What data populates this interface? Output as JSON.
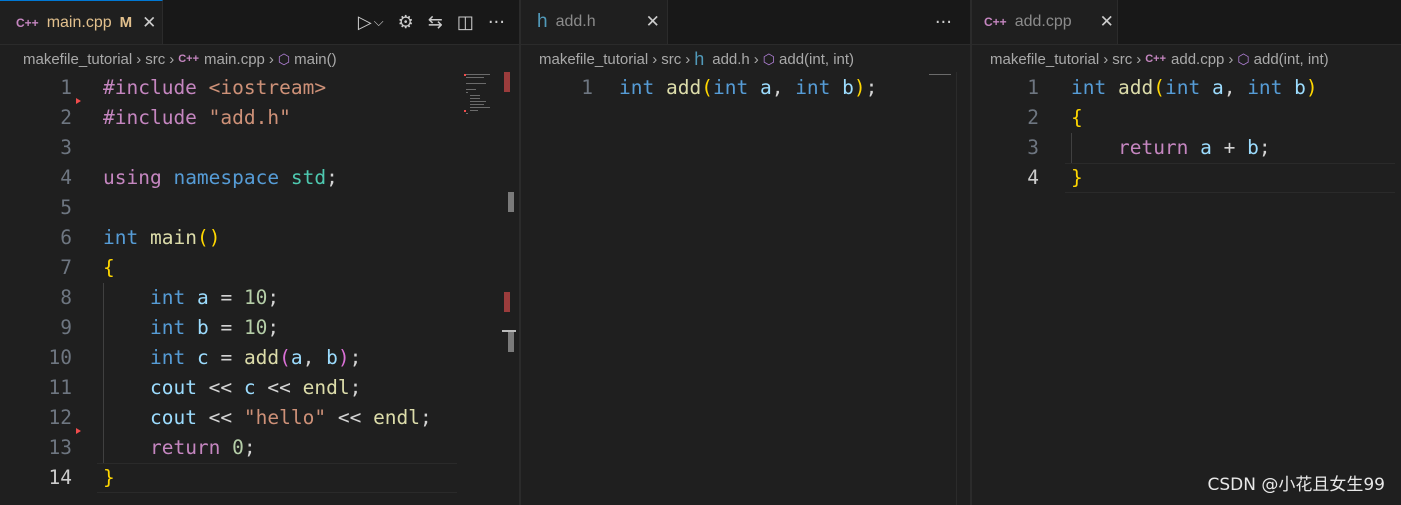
{
  "panes": {
    "main": {
      "tab": {
        "icon": "C++",
        "name": "main.cpp",
        "status": "M",
        "close": "✕"
      },
      "actions": {
        "run": "▷",
        "run_dropdown": "⌵",
        "settings": "⚙",
        "compare": "⇆",
        "split": "◫",
        "more": "···"
      },
      "breadcrumb": {
        "folder": "makefile_tutorial",
        "sub": "src",
        "file_icon": "C++",
        "file": "main.cpp",
        "symbol": "main()"
      },
      "line_numbers": [
        "1",
        "2",
        "3",
        "4",
        "5",
        "6",
        "7",
        "8",
        "9",
        "10",
        "11",
        "12",
        "13",
        "14"
      ]
    },
    "header": {
      "tab": {
        "icon": "h",
        "name": "add.h",
        "close": "✕"
      },
      "actions": {
        "more": "···"
      },
      "breadcrumb": {
        "folder": "makefile_tutorial",
        "sub": "src",
        "file_icon": "h",
        "file": "add.h",
        "symbol": "add(int, int)"
      },
      "line_numbers": [
        "1"
      ]
    },
    "impl": {
      "tab": {
        "icon": "C++",
        "name": "add.cpp",
        "close": "✕"
      },
      "breadcrumb": {
        "folder": "makefile_tutorial",
        "sub": "src",
        "file_icon": "C++",
        "file": "add.cpp",
        "symbol": "add(int, int)"
      },
      "line_numbers": [
        "1",
        "2",
        "3",
        "4"
      ]
    }
  },
  "code": {
    "main": [
      [
        [
          "#include",
          "pp"
        ],
        [
          " ",
          "p"
        ],
        [
          "<iostream>",
          "s"
        ]
      ],
      [
        [
          "#include",
          "pp"
        ],
        [
          " ",
          "p"
        ],
        [
          "\"add.h\"",
          "s"
        ]
      ],
      [],
      [
        [
          "using",
          "pp"
        ],
        [
          " ",
          "p"
        ],
        [
          "namespace",
          "k"
        ],
        [
          " ",
          "p"
        ],
        [
          "std",
          "t"
        ],
        [
          ";",
          "p"
        ]
      ],
      [],
      [
        [
          "int",
          "k"
        ],
        [
          " ",
          "p"
        ],
        [
          "main",
          "f"
        ],
        [
          "()",
          "b1"
        ]
      ],
      [
        [
          "{",
          "b1"
        ]
      ],
      [
        [
          "    ",
          "p"
        ],
        [
          "int",
          "k"
        ],
        [
          " ",
          "p"
        ],
        [
          "a",
          "v"
        ],
        [
          " = ",
          "p"
        ],
        [
          "10",
          "n"
        ],
        [
          ";",
          "p"
        ]
      ],
      [
        [
          "    ",
          "p"
        ],
        [
          "int",
          "k"
        ],
        [
          " ",
          "p"
        ],
        [
          "b",
          "v"
        ],
        [
          " = ",
          "p"
        ],
        [
          "10",
          "n"
        ],
        [
          ";",
          "p"
        ]
      ],
      [
        [
          "    ",
          "p"
        ],
        [
          "int",
          "k"
        ],
        [
          " ",
          "p"
        ],
        [
          "c",
          "v"
        ],
        [
          " = ",
          "p"
        ],
        [
          "add",
          "f"
        ],
        [
          "(",
          "b2"
        ],
        [
          "a",
          "v"
        ],
        [
          ", ",
          "p"
        ],
        [
          "b",
          "v"
        ],
        [
          ")",
          "b2"
        ],
        [
          ";",
          "p"
        ]
      ],
      [
        [
          "    ",
          "p"
        ],
        [
          "cout",
          "v"
        ],
        [
          " << ",
          "p"
        ],
        [
          "c",
          "v"
        ],
        [
          " << ",
          "p"
        ],
        [
          "endl",
          "f"
        ],
        [
          ";",
          "p"
        ]
      ],
      [
        [
          "    ",
          "p"
        ],
        [
          "cout",
          "v"
        ],
        [
          " << ",
          "p"
        ],
        [
          "\"hello\"",
          "s"
        ],
        [
          " << ",
          "p"
        ],
        [
          "endl",
          "f"
        ],
        [
          ";",
          "p"
        ]
      ],
      [
        [
          "    ",
          "p"
        ],
        [
          "return",
          "pp"
        ],
        [
          " ",
          "p"
        ],
        [
          "0",
          "n"
        ],
        [
          ";",
          "p"
        ]
      ],
      [
        [
          "}",
          "b1"
        ]
      ]
    ],
    "header": [
      [
        [
          "int",
          "k"
        ],
        [
          " ",
          "p"
        ],
        [
          "add",
          "f"
        ],
        [
          "(",
          "b1"
        ],
        [
          "int",
          "k"
        ],
        [
          " ",
          "p"
        ],
        [
          "a",
          "v"
        ],
        [
          ", ",
          "p"
        ],
        [
          "int",
          "k"
        ],
        [
          " ",
          "p"
        ],
        [
          "b",
          "v"
        ],
        [
          ")",
          "b1"
        ],
        [
          ";",
          "p"
        ]
      ]
    ],
    "impl": [
      [
        [
          "int",
          "k"
        ],
        [
          " ",
          "p"
        ],
        [
          "add",
          "f"
        ],
        [
          "(",
          "b1"
        ],
        [
          "int",
          "k"
        ],
        [
          " ",
          "p"
        ],
        [
          "a",
          "v"
        ],
        [
          ", ",
          "p"
        ],
        [
          "int",
          "k"
        ],
        [
          " ",
          "p"
        ],
        [
          "b",
          "v"
        ],
        [
          ")",
          "b1"
        ]
      ],
      [
        [
          "{",
          "b1"
        ]
      ],
      [
        [
          "    ",
          "p"
        ],
        [
          "return",
          "pp"
        ],
        [
          " ",
          "p"
        ],
        [
          "a",
          "v"
        ],
        [
          " + ",
          "p"
        ],
        [
          "b",
          "v"
        ],
        [
          ";",
          "p"
        ]
      ],
      [
        [
          "}",
          "b1"
        ]
      ]
    ]
  },
  "colors": {
    "keyword": "#569cd6",
    "control": "#c586c0",
    "string": "#ce9178",
    "function": "#dcdcaa",
    "variable": "#9cdcfe",
    "type": "#4ec9b0",
    "number": "#b5cea8",
    "bracket_gold": "#ffd700",
    "bracket_violet": "#da70d6",
    "background": "#1f1f1f",
    "modified": "#e2c08d"
  },
  "current_line": {
    "main": 14,
    "impl": 4
  },
  "watermark": "CSDN @小花且女生99"
}
